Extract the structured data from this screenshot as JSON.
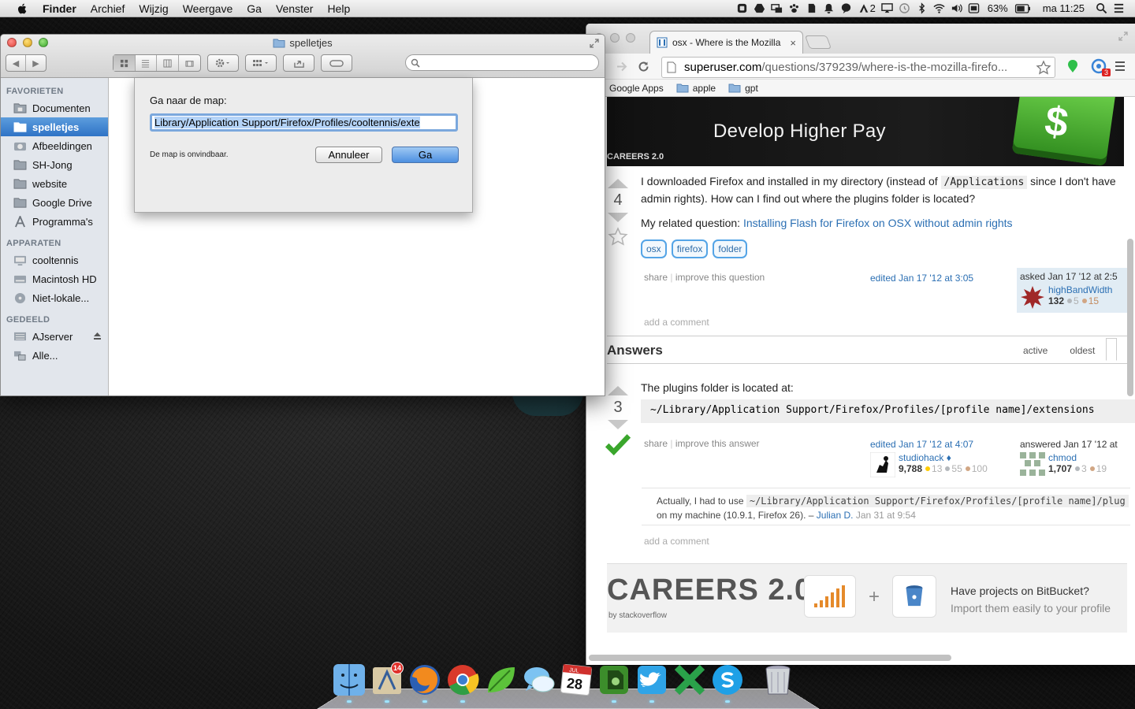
{
  "menubar": {
    "app": "Finder",
    "menus": [
      "Archief",
      "Wijzig",
      "Weergave",
      "Ga",
      "Venster",
      "Help"
    ],
    "status_number": "2",
    "battery": "63%",
    "clock": "ma 11:25"
  },
  "finder": {
    "title": "spelletjes",
    "search_placeholder": "",
    "sidebar": {
      "favorites_header": "FAVORIETEN",
      "favorites": [
        "Documenten",
        "spelletjes",
        "Afbeeldingen",
        "SH-Jong",
        "website",
        "Google Drive",
        "Programma's"
      ],
      "devices_header": "APPARATEN",
      "devices": [
        "cooltennis",
        "Macintosh HD",
        "Niet-lokale..."
      ],
      "shared_header": "GEDEELD",
      "shared": [
        "AJserver",
        "Alle..."
      ]
    },
    "dialog": {
      "prompt": "Ga naar de map:",
      "path_value": "Library/Application Support/Firefox/Profiles/cooltennis/exte",
      "error": "De map is onvindbaar.",
      "cancel": "Annuleer",
      "go": "Ga"
    }
  },
  "chrome": {
    "tab_title": "osx - Where is the Mozilla",
    "tab_close": "×",
    "url_host": "superuser.com",
    "url_path": "/questions/379239/where-is-the-mozilla-firefo...",
    "extension_badge": "3",
    "bookmarks": [
      "Google Apps",
      "apple",
      "gpt"
    ],
    "banner": {
      "headline": "Develop Higher Pay",
      "brand": "CAREERS 2.0",
      "key_symbol": "$"
    },
    "question": {
      "text_before": "I downloaded Firefox and installed in my directory (instead of",
      "code": "/Applications",
      "text_after": "since I don't have admin rights). How can I find out where the plugins folder is located?",
      "related_prefix": "My related question:",
      "related_link": "Installing Flash for Firefox on OSX without admin rights",
      "votes": "4",
      "tags": [
        "osx",
        "firefox",
        "folder"
      ],
      "share": "share",
      "improve": "improve this question",
      "edited": "edited Jan 17 '12 at 3:05",
      "asked": "asked Jan 17 '12 at 2:5",
      "asker": "highBandWidth",
      "asker_rep": "132",
      "asker_silver": "5",
      "asker_bronze": "15",
      "add_comment": "add a comment"
    },
    "answers_header": "Answers",
    "sort_tabs": [
      "active",
      "oldest"
    ],
    "answer": {
      "votes": "3",
      "text": "The plugins folder is located at:",
      "code": "~/Library/Application Support/Firefox/Profiles/[profile name]/extensions",
      "share": "share",
      "improve": "improve this answer",
      "edited": "edited Jan 17 '12 at 4:07",
      "editor": "studiohack",
      "editor_mod": "♦",
      "editor_rep": "9,788",
      "editor_gold": "13",
      "editor_silver": "55",
      "editor_bronze": "100",
      "answered": "answered Jan 17 '12 at",
      "answerer": "chmod",
      "answerer_rep": "1,707",
      "answerer_silver": "3",
      "answerer_bronze": "19",
      "comment_before": "Actually, I had to use",
      "comment_code": "~/Library/Application Support/Firefox/Profiles/[profile name]/plug",
      "comment_after": "on my machine (10.9.1, Firefox 26). –",
      "comment_user": "Julian D.",
      "comment_time": "Jan 31 at 9:54",
      "add_comment": "add a comment"
    },
    "footer_ad": {
      "logo": "CAREERS 2.0",
      "logo_sub": "by stackoverflow",
      "plus": "+",
      "line1": "Have projects on BitBucket?",
      "line2": "Import them easily to your profile"
    }
  },
  "dock": {
    "mail_badge": "14",
    "calendar_month": "JUL",
    "calendar_day": "28"
  },
  "colors": {
    "selection": "#3a7fd0",
    "link": "#2b6fb3",
    "accepted": "#3aa62c"
  }
}
